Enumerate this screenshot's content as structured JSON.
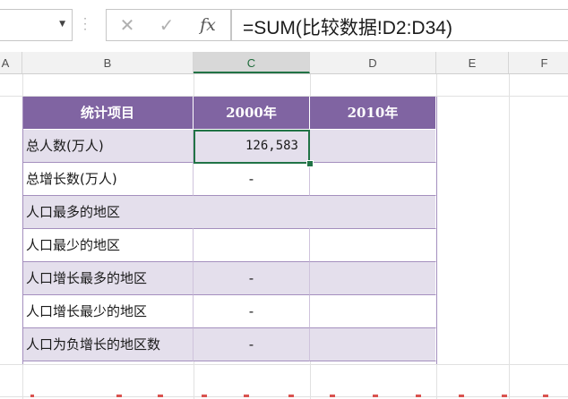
{
  "formula_bar": {
    "name_box": "",
    "cancel_icon": "close-icon",
    "enter_icon": "check-icon",
    "function_label": "fx",
    "formula": "=SUM(比较数据!D2:D34)"
  },
  "columns": [
    {
      "label": "A",
      "active": false
    },
    {
      "label": "B",
      "active": false
    },
    {
      "label": "C",
      "active": true
    },
    {
      "label": "D",
      "active": false
    },
    {
      "label": "E",
      "active": false
    },
    {
      "label": "F",
      "active": false
    }
  ],
  "table": {
    "header": [
      "统计项目",
      "2000年",
      "2010年"
    ],
    "rows": [
      [
        "总人数(万人)",
        "126,583",
        ""
      ],
      [
        "总增长数(万人)",
        "-",
        ""
      ],
      [
        "人口最多的地区",
        "",
        ""
      ],
      [
        "人口最少的地区",
        "",
        ""
      ],
      [
        "人口增长最多的地区",
        "-",
        ""
      ],
      [
        "人口增长最少的地区",
        "-",
        ""
      ],
      [
        "人口为负增长的地区数",
        "-",
        ""
      ]
    ]
  },
  "selected_cell": "C",
  "colors": {
    "header_bg": "#8064a2",
    "band_bg": "#e4dfec",
    "selection": "#217346"
  }
}
